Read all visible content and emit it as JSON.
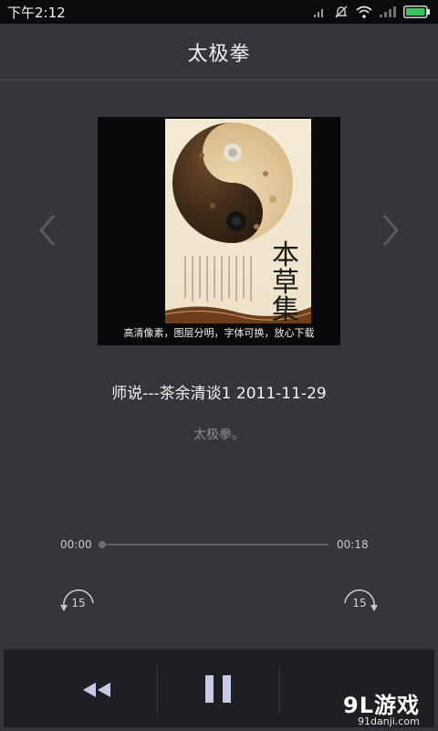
{
  "status_bar": {
    "time": "下午2:12",
    "icons": [
      "signal-icon",
      "mute-icon",
      "wifi-icon",
      "cellular-icon",
      "battery-icon"
    ]
  },
  "header": {
    "title": "太极拳"
  },
  "artwork": {
    "caption": "高清像素，图层分明，字体可换，放心下载",
    "calligraphy": "本草集"
  },
  "track": {
    "title": "师说---茶余清谈1 2011-11-29",
    "subtitle": "太极拳。"
  },
  "progress": {
    "elapsed": "00:00",
    "duration": "00:18",
    "fraction": 0.0
  },
  "skip": {
    "back_seconds": "15",
    "forward_seconds": "15"
  },
  "controls": {
    "icons": [
      "rewind-icon",
      "pause-icon"
    ]
  },
  "watermark": {
    "main": "9L游戏",
    "sub": "91danji.com"
  },
  "colors": {
    "background": "#34363b",
    "status_bar": "#0b0b0c",
    "control_bar": "#1e1f23",
    "subtitle": "#8a8d96"
  }
}
